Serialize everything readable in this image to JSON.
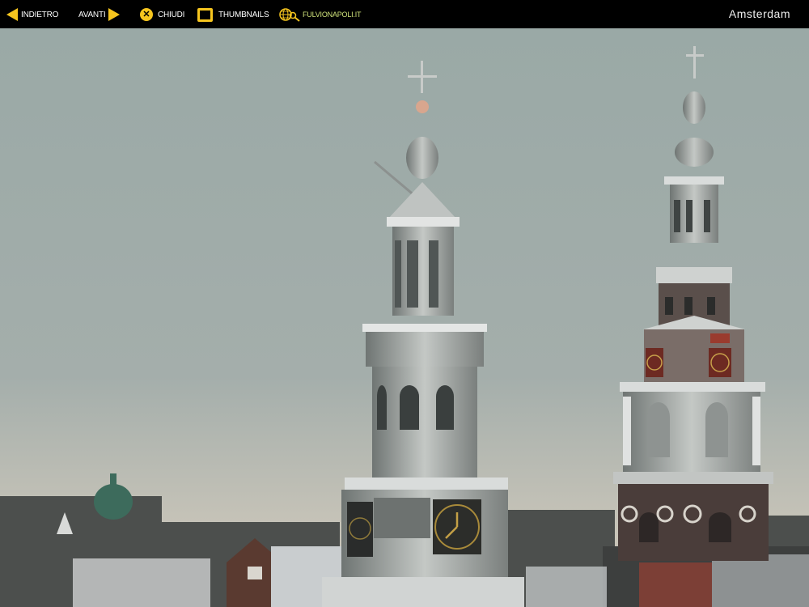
{
  "toolbar": {
    "back_label": "INDIETRO",
    "forward_label": "AVANTI",
    "close_label": "CHIUDI",
    "thumbnails_label": "THUMBNAILS",
    "site_label": "FULVIONAPOLI.IT"
  },
  "page": {
    "title": "Amsterdam"
  },
  "icons": {
    "back": "arrow-left-icon",
    "forward": "arrow-right-icon",
    "close": "close-icon",
    "thumbnails": "thumbnails-icon",
    "site": "globe-search-icon"
  },
  "colors": {
    "accent": "#f6c51e",
    "site_link": "#cfe27a",
    "bar": "#000000"
  }
}
